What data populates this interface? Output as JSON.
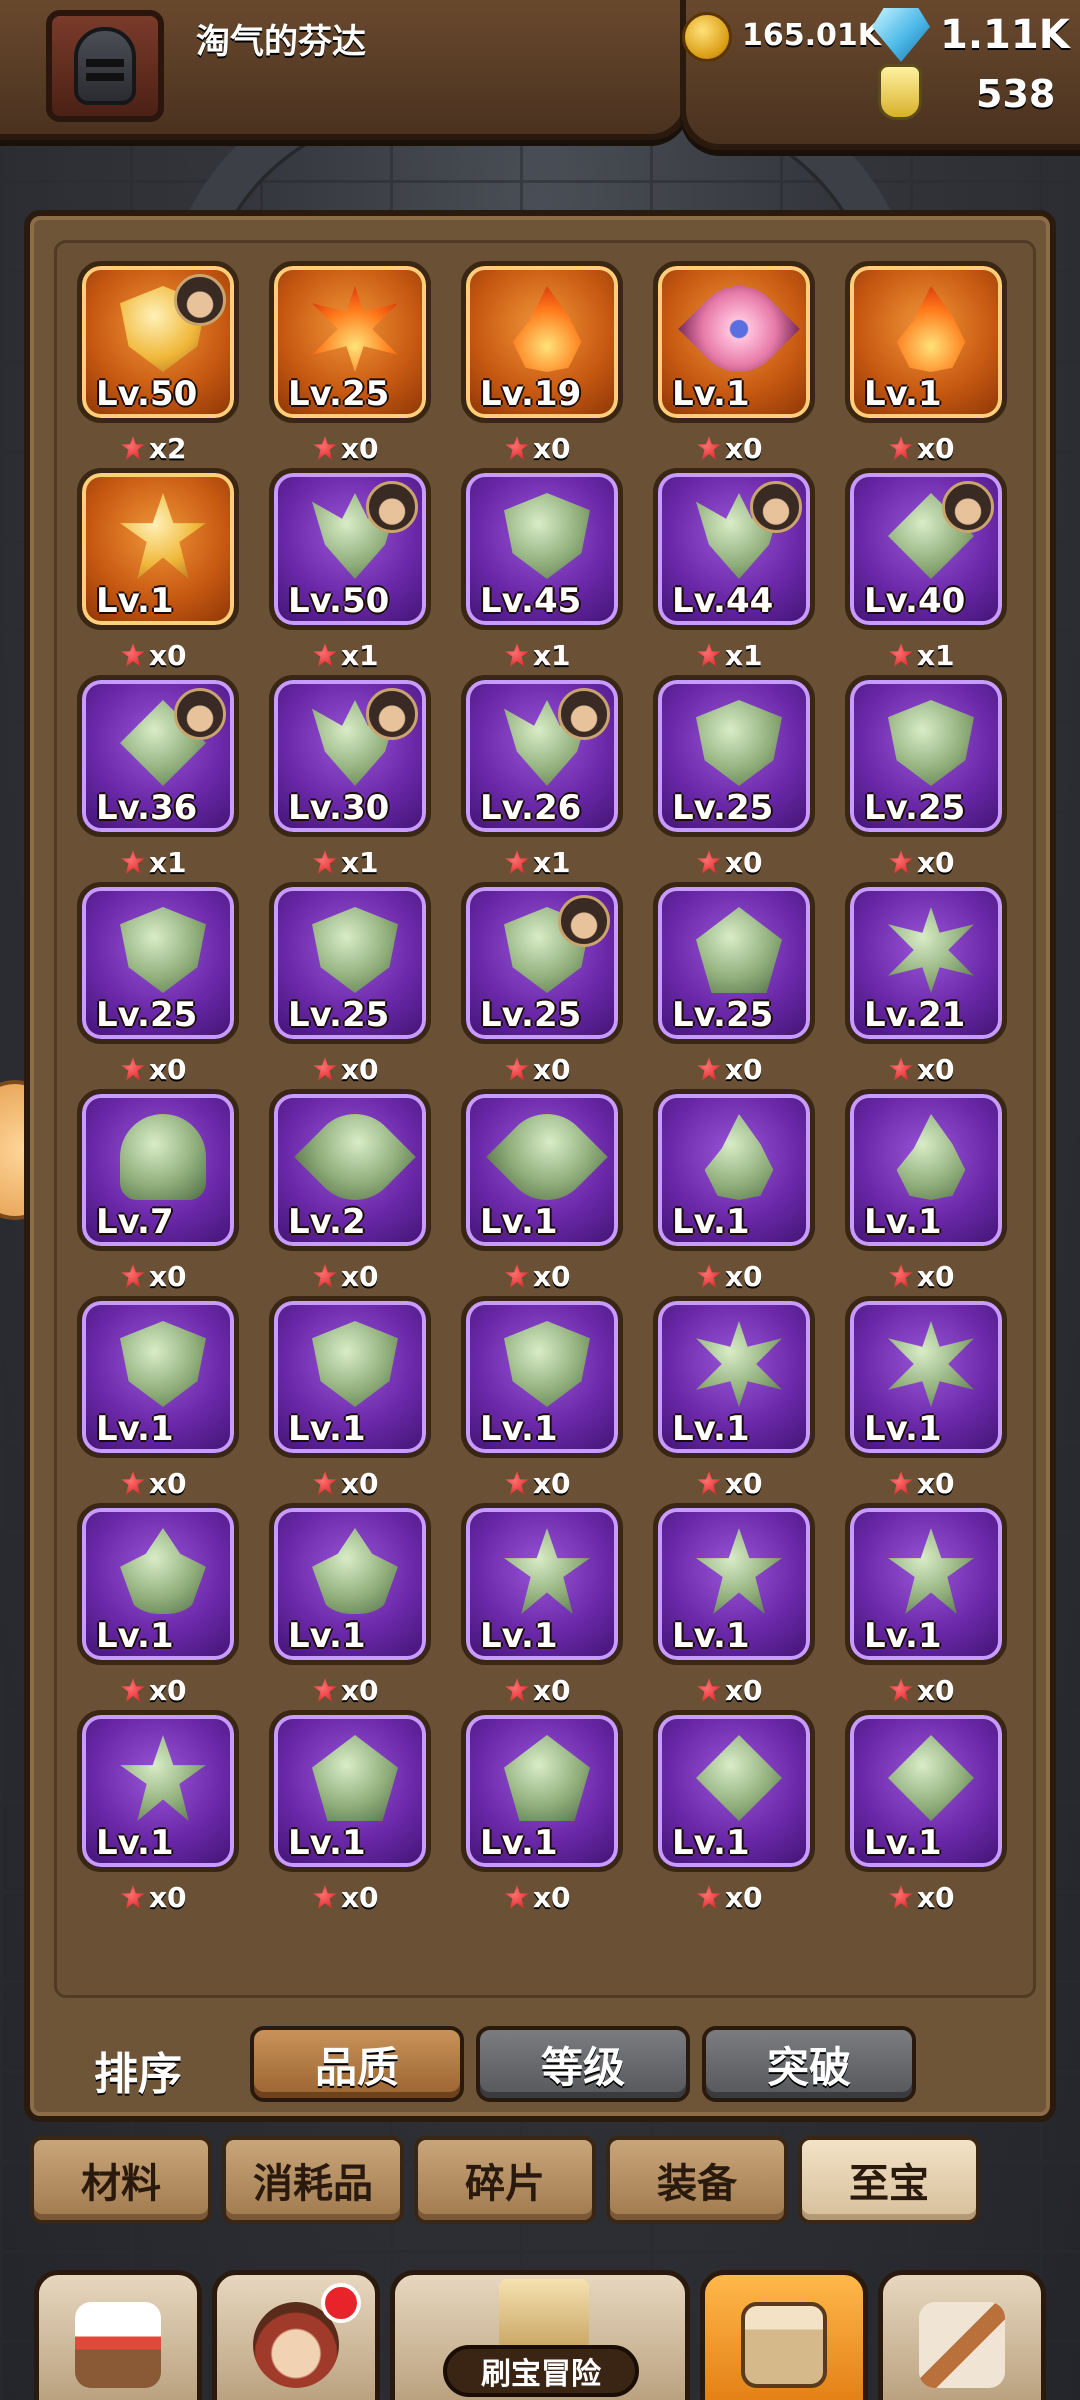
{
  "header": {
    "player_name": "淘气的芬达",
    "gold": "165.01K",
    "gems": "1.11K",
    "potions": "538"
  },
  "items": [
    {
      "level": "Lv.50",
      "count": "x2",
      "rarity": "orange",
      "emblem": "gold-cross-icon",
      "has_portrait": true
    },
    {
      "level": "Lv.25",
      "count": "x0",
      "rarity": "orange",
      "emblem": "fire-crown-icon",
      "has_portrait": false
    },
    {
      "level": "Lv.19",
      "count": "x0",
      "rarity": "orange",
      "emblem": "flame-icon",
      "has_portrait": false
    },
    {
      "level": "Lv.1",
      "count": "x0",
      "rarity": "orange",
      "emblem": "pink-flower-icon",
      "has_portrait": false
    },
    {
      "level": "Lv.1",
      "count": "x0",
      "rarity": "orange",
      "emblem": "flame-icon",
      "has_portrait": false
    },
    {
      "level": "Lv.1",
      "count": "x0",
      "rarity": "orange",
      "emblem": "star-medal-icon",
      "has_portrait": false
    },
    {
      "level": "Lv.50",
      "count": "x1",
      "rarity": "purple",
      "emblem": "wing-emblem-icon",
      "has_portrait": true
    },
    {
      "level": "Lv.45",
      "count": "x1",
      "rarity": "purple",
      "emblem": "shield-emblem-icon",
      "has_portrait": false
    },
    {
      "level": "Lv.44",
      "count": "x1",
      "rarity": "purple",
      "emblem": "wing-emblem-icon",
      "has_portrait": true
    },
    {
      "level": "Lv.40",
      "count": "x1",
      "rarity": "purple",
      "emblem": "cross-emblem-icon",
      "has_portrait": true
    },
    {
      "level": "Lv.36",
      "count": "x1",
      "rarity": "purple",
      "emblem": "cross-emblem-icon",
      "has_portrait": true
    },
    {
      "level": "Lv.30",
      "count": "x1",
      "rarity": "purple",
      "emblem": "wing-emblem-icon",
      "has_portrait": true
    },
    {
      "level": "Lv.26",
      "count": "x1",
      "rarity": "purple",
      "emblem": "wing-emblem-icon",
      "has_portrait": true
    },
    {
      "level": "Lv.25",
      "count": "x0",
      "rarity": "purple",
      "emblem": "shield-emblem-icon",
      "has_portrait": false
    },
    {
      "level": "Lv.25",
      "count": "x0",
      "rarity": "purple",
      "emblem": "shield-emblem-icon",
      "has_portrait": false
    },
    {
      "level": "Lv.25",
      "count": "x0",
      "rarity": "purple",
      "emblem": "shield-emblem-icon",
      "has_portrait": false
    },
    {
      "level": "Lv.25",
      "count": "x0",
      "rarity": "purple",
      "emblem": "shield-emblem-icon",
      "has_portrait": false
    },
    {
      "level": "Lv.25",
      "count": "x0",
      "rarity": "purple",
      "emblem": "shield-emblem-icon",
      "has_portrait": true
    },
    {
      "level": "Lv.25",
      "count": "x0",
      "rarity": "purple",
      "emblem": "pentagon-emblem-icon",
      "has_portrait": false
    },
    {
      "level": "Lv.21",
      "count": "x0",
      "rarity": "purple",
      "emblem": "spike-emblem-icon",
      "has_portrait": false
    },
    {
      "level": "Lv.7",
      "count": "x0",
      "rarity": "purple",
      "emblem": "orb-emblem-icon",
      "has_portrait": false
    },
    {
      "level": "Lv.2",
      "count": "x0",
      "rarity": "purple",
      "emblem": "flower-emblem-icon",
      "has_portrait": false
    },
    {
      "level": "Lv.1",
      "count": "x0",
      "rarity": "purple",
      "emblem": "flower-emblem-icon",
      "has_portrait": false
    },
    {
      "level": "Lv.1",
      "count": "x0",
      "rarity": "purple",
      "emblem": "flame-emblem-icon",
      "has_portrait": false
    },
    {
      "level": "Lv.1",
      "count": "x0",
      "rarity": "purple",
      "emblem": "flame-emblem-icon",
      "has_portrait": false
    },
    {
      "level": "Lv.1",
      "count": "x0",
      "rarity": "purple",
      "emblem": "helm-emblem-icon",
      "has_portrait": false
    },
    {
      "level": "Lv.1",
      "count": "x0",
      "rarity": "purple",
      "emblem": "helm-emblem-icon",
      "has_portrait": false
    },
    {
      "level": "Lv.1",
      "count": "x0",
      "rarity": "purple",
      "emblem": "helm-emblem-icon",
      "has_portrait": false
    },
    {
      "level": "Lv.1",
      "count": "x0",
      "rarity": "purple",
      "emblem": "spike-emblem-icon",
      "has_portrait": false
    },
    {
      "level": "Lv.1",
      "count": "x0",
      "rarity": "purple",
      "emblem": "spike-emblem-icon",
      "has_portrait": false
    },
    {
      "level": "Lv.1",
      "count": "x0",
      "rarity": "purple",
      "emblem": "fleur-emblem-icon",
      "has_portrait": false
    },
    {
      "level": "Lv.1",
      "count": "x0",
      "rarity": "purple",
      "emblem": "fleur-emblem-icon",
      "has_portrait": false
    },
    {
      "level": "Lv.1",
      "count": "x0",
      "rarity": "purple",
      "emblem": "star-emblem-icon",
      "has_portrait": false
    },
    {
      "level": "Lv.1",
      "count": "x0",
      "rarity": "purple",
      "emblem": "star-emblem-icon",
      "has_portrait": false
    },
    {
      "level": "Lv.1",
      "count": "x0",
      "rarity": "purple",
      "emblem": "star-emblem-icon",
      "has_portrait": false
    },
    {
      "level": "Lv.1",
      "count": "x0",
      "rarity": "purple",
      "emblem": "star-emblem-icon",
      "has_portrait": false
    },
    {
      "level": "Lv.1",
      "count": "x0",
      "rarity": "purple",
      "emblem": "pentagon-emblem-icon",
      "has_portrait": false
    },
    {
      "level": "Lv.1",
      "count": "x0",
      "rarity": "purple",
      "emblem": "pentagon-emblem-icon",
      "has_portrait": false
    },
    {
      "level": "Lv.1",
      "count": "x0",
      "rarity": "purple",
      "emblem": "diamond-emblem-icon",
      "has_portrait": false
    },
    {
      "level": "Lv.1",
      "count": "x0",
      "rarity": "purple",
      "emblem": "diamond-emblem-icon",
      "has_portrait": false
    }
  ],
  "sort": {
    "label": "排序",
    "options": [
      {
        "label": "品质",
        "active": true
      },
      {
        "label": "等级",
        "active": false
      },
      {
        "label": "突破",
        "active": false
      }
    ]
  },
  "categories": [
    {
      "label": "材料",
      "active": false
    },
    {
      "label": "消耗品",
      "active": false
    },
    {
      "label": "碎片",
      "active": false
    },
    {
      "label": "装备",
      "active": false
    },
    {
      "label": "至宝",
      "active": true
    }
  ],
  "bottom_nav": {
    "center_label": "刷宝冒险",
    "items": [
      "shop-icon",
      "hero-icon",
      "treasure-map-icon",
      "backpack-icon",
      "forge-icon"
    ],
    "active": "backpack-icon"
  }
}
